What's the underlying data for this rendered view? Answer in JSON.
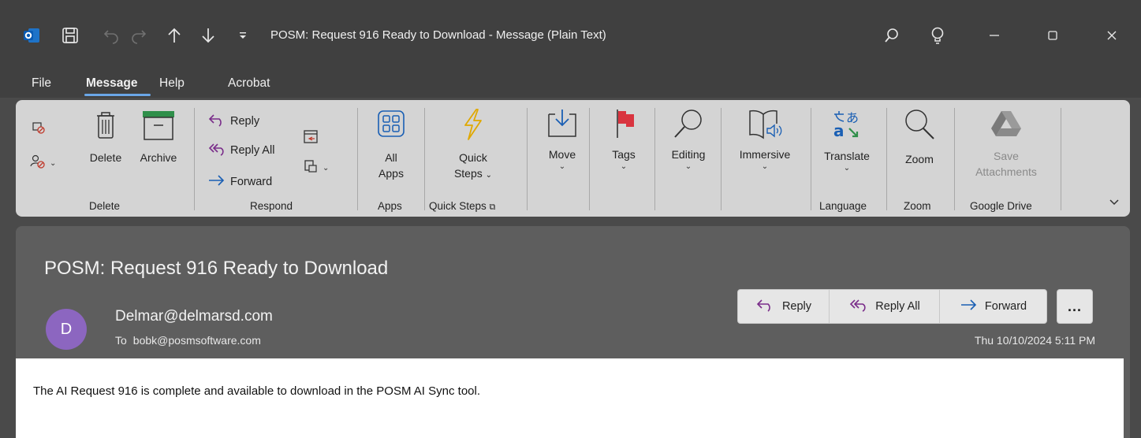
{
  "window": {
    "title": "POSM: Request 916 Ready to Download  -  Message (Plain Text)",
    "icons": [
      "outlook-icon",
      "save-icon",
      "undo-icon",
      "redo-icon",
      "arrow-up-icon",
      "arrow-down-icon",
      "customize-icon",
      "search-icon",
      "lightbulb-icon",
      "minimize-icon",
      "maximize-icon",
      "close-icon"
    ]
  },
  "menu": {
    "items": [
      "File",
      "Message",
      "Help",
      "Acrobat"
    ],
    "active": "Message"
  },
  "ribbon": {
    "delete_group": {
      "label": "Delete",
      "delete": "Delete",
      "archive": "Archive"
    },
    "respond_group": {
      "label": "Respond",
      "reply": "Reply",
      "reply_all": "Reply All",
      "forward": "Forward"
    },
    "apps_group": {
      "label": "Apps",
      "all_apps_line1": "All",
      "all_apps_line2": "Apps"
    },
    "quick_steps_group": {
      "label": "Quick Steps",
      "quick_line1": "Quick",
      "quick_line2": "Steps"
    },
    "move": "Move",
    "tags": "Tags",
    "editing": "Editing",
    "immersive": "Immersive",
    "language_group": {
      "label": "Language",
      "translate": "Translate"
    },
    "zoom_group": {
      "label": "Zoom",
      "zoom": "Zoom"
    },
    "google_drive_group": {
      "label": "Google Drive",
      "save_line1": "Save",
      "save_line2": "Attachments"
    }
  },
  "message": {
    "subject": "POSM: Request 916 Ready to Download",
    "avatar_initial": "D",
    "avatar_color": "#8c66c0",
    "sender": "Delmar@delmarsd.com",
    "to_label": "To",
    "to_address": "bobk@posmsoftware.com",
    "date": "Thu 10/10/2024 5:11 PM",
    "actions": {
      "reply": "Reply",
      "reply_all": "Reply All",
      "forward": "Forward",
      "more": "..."
    },
    "body": "The AI Request 916 is complete and available to download in the POSM AI Sync tool."
  }
}
